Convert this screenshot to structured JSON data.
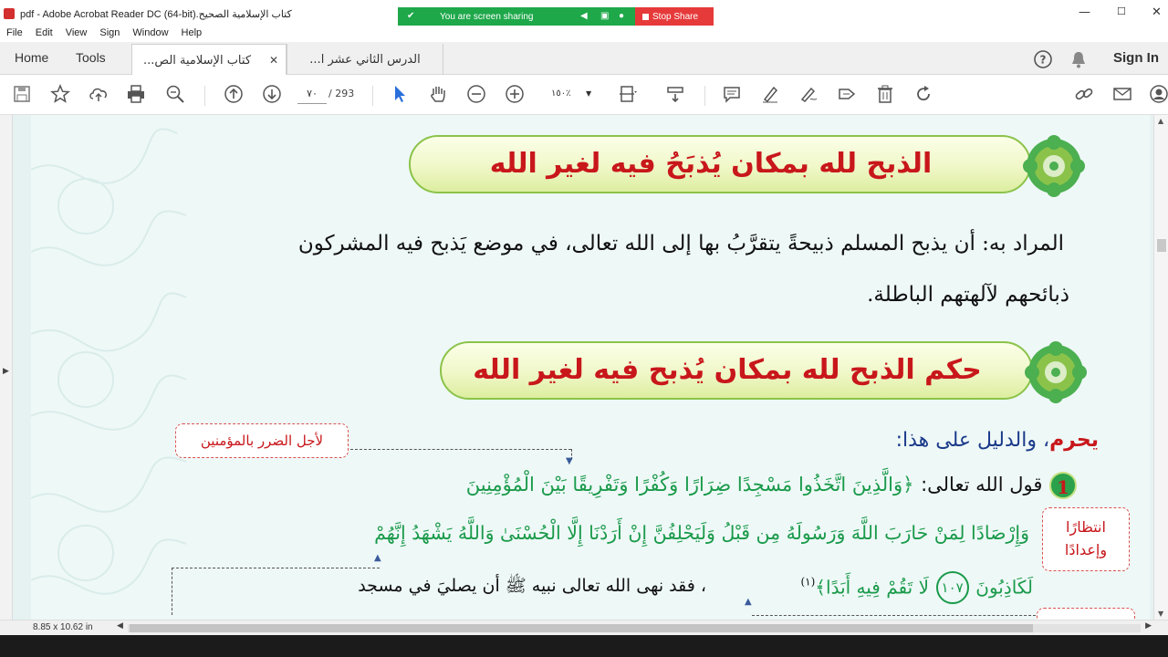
{
  "window": {
    "title": "كتاب الإسلامية الصحيح.pdf - Adobe Acrobat Reader DC (64-bit)",
    "minimize": "—",
    "maximize": "☐",
    "close": "✕"
  },
  "screen_share": {
    "status": "You are screen sharing",
    "stop_label": "Stop Share",
    "bar_color": "#1ea84a",
    "stop_color": "#e63a3a"
  },
  "menu": [
    "File",
    "Edit",
    "View",
    "Sign",
    "Window",
    "Help"
  ],
  "tabs": {
    "home": "Home",
    "tools": "Tools",
    "documents": [
      {
        "label": "كتاب الإسلامية الص...",
        "active": true,
        "close": "✕"
      },
      {
        "label": "الدرس الثاني عشر ا...",
        "active": false
      }
    ],
    "sign_in": "Sign In"
  },
  "toolbar": {
    "current_page": "٧٠",
    "total_pages": "/  293",
    "zoom": "١٥٠٪"
  },
  "document": {
    "heading1": "الذبح لله بمكان يُذبَحُ فيه لغير الله",
    "para_line1": "المراد به: أن يذبح المسلم ذبيحةً يتقرَّبُ بها إلى الله تعالى، في موضع يَذبح فيه المشركون",
    "para_line2": "ذبائحهم لآلهتهم الباطلة.",
    "heading2": "حكم الذبح لله بمكان يُذبح فيه لغير الله",
    "ruling_word": "يحرم",
    "ruling_rest": "، والدليل على هذا:",
    "note_harm": "لأجل الضرر بالمؤمنين",
    "note_wait_1": "انتظارًا",
    "note_wait_2": "وإعدادًا",
    "item_number": "1",
    "item_intro": "قول الله تعالى:",
    "verse_line1": "﴿وَالَّذِينَ اتَّخَذُوا مَسْجِدًا ضِرَارًا وَكُفْرًا وَتَفْرِيقًا بَيْنَ الْمُؤْمِنِينَ",
    "verse_line2": "وَإِرْصَادًا لِمَنْ حَارَبَ اللَّهَ وَرَسُولَهُ مِن قَبْلُ وَلَيَحْلِفُنَّ إِنْ أَرَدْنَا إِلَّا الْحُسْنَىٰ وَاللَّهُ يَشْهَدُ إِنَّهُمْ",
    "verse_line3a": "لَكَاذِبُونَ",
    "ayah_number": "١٠٧",
    "verse_line3b": "لَا تَقُمْ فِيهِ أَبَدًا﴾",
    "footnote_ref": "(١)",
    "after_verse": "، فقد نهى الله تعالى نبيه ﷺ أن يصليَ في مسجد"
  },
  "status": {
    "page_size": "8.85 x 10.62 in"
  },
  "colors": {
    "heading_red": "#c8171b",
    "verse_green": "#1a9a4a",
    "evidence_blue": "#1a3a8a",
    "page_bg": "#eef8f7"
  }
}
